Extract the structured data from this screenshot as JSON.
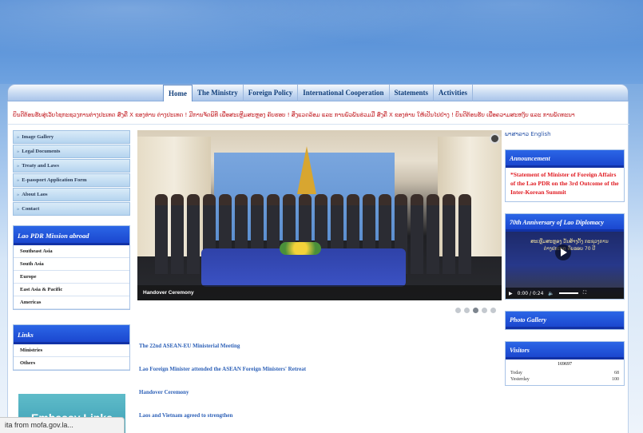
{
  "nav": {
    "items": [
      "Home",
      "The Ministry",
      "Foreign Policy",
      "International Cooperation",
      "Statements",
      "Activities"
    ],
    "active": 0
  },
  "ticker": "ຍິນດີຕ້ອນຮັບສູ່ເວັບໄຊກະຊວງການຕ່າງປະເທດ ສົ່ງຄື X ຂອງທ່ານ ຕ່າງປະເທດ ! ມີການຈັດພິທີ ເພື່ອສະເຫຼີມສະຫຼອງ ຄົບຮອບ ! ສິ່ງແວດລ້ອມ ແລະ ການພົວພັນຮ່ວມມື ສົ່ງຄື X ຂອງທ່ານ ໃຫ້ເປັນໄປຢ່າງ ! ຍິນດີຕ້ອນຮັບ ເພື່ອຄວາມສະຫງົບ ແລະ ການພັດທະນາ",
  "left_menu": [
    "Image Gallery",
    "Legal Documents",
    "Treaty and Laws",
    "E-passport Application Form",
    "About Laos",
    "Contact"
  ],
  "mission": {
    "title": "Lao PDR Mission abroad",
    "items": [
      "Southeast Asia",
      "South Asia",
      "Europe",
      "East Asia & Pacific",
      "Americas"
    ]
  },
  "links": {
    "title": "Links",
    "items": [
      "Ministries",
      "Others"
    ]
  },
  "embassy_banner": "Embassy Links",
  "slider": {
    "caption": "Handover Ceremony",
    "dots": 5,
    "active_dot": 2
  },
  "news": [
    "The 22nd ASEAN-EU Ministerial Meeting",
    "Lao Foreign Minister attended the ASEAN Foreign Ministers' Retreat",
    "Handover Ceremony",
    "Laos and Vietnam agreed to strengthen"
  ],
  "languages": [
    "ພາສາລາວ",
    "English"
  ],
  "announcement": {
    "title": "Announcement",
    "text": "*Statement of Minister of Foreign Affairs of the Lao PDR on the 3rd Outcome of the Inter-Korean Summit"
  },
  "video": {
    "title": "70th Anniversary of Lao Diplomacy",
    "overlay_text": "ສະເຫຼີມສະຫຼອງ ວັນສ້າງຕັ້ງ ກະຊວງການຕ່າງປະເທດ ຄົບຮອບ 70 ປີ",
    "time": "0:00 / 0:24"
  },
  "photo_gallery": {
    "title": "Photo Gallery"
  },
  "visitors": {
    "title": "Visitors",
    "total": "169697",
    "rows": [
      {
        "label": "Today",
        "value": "68"
      },
      {
        "label": "Yesterday",
        "value": "100"
      }
    ]
  },
  "status_bar": "ita from mofa.gov.la..."
}
